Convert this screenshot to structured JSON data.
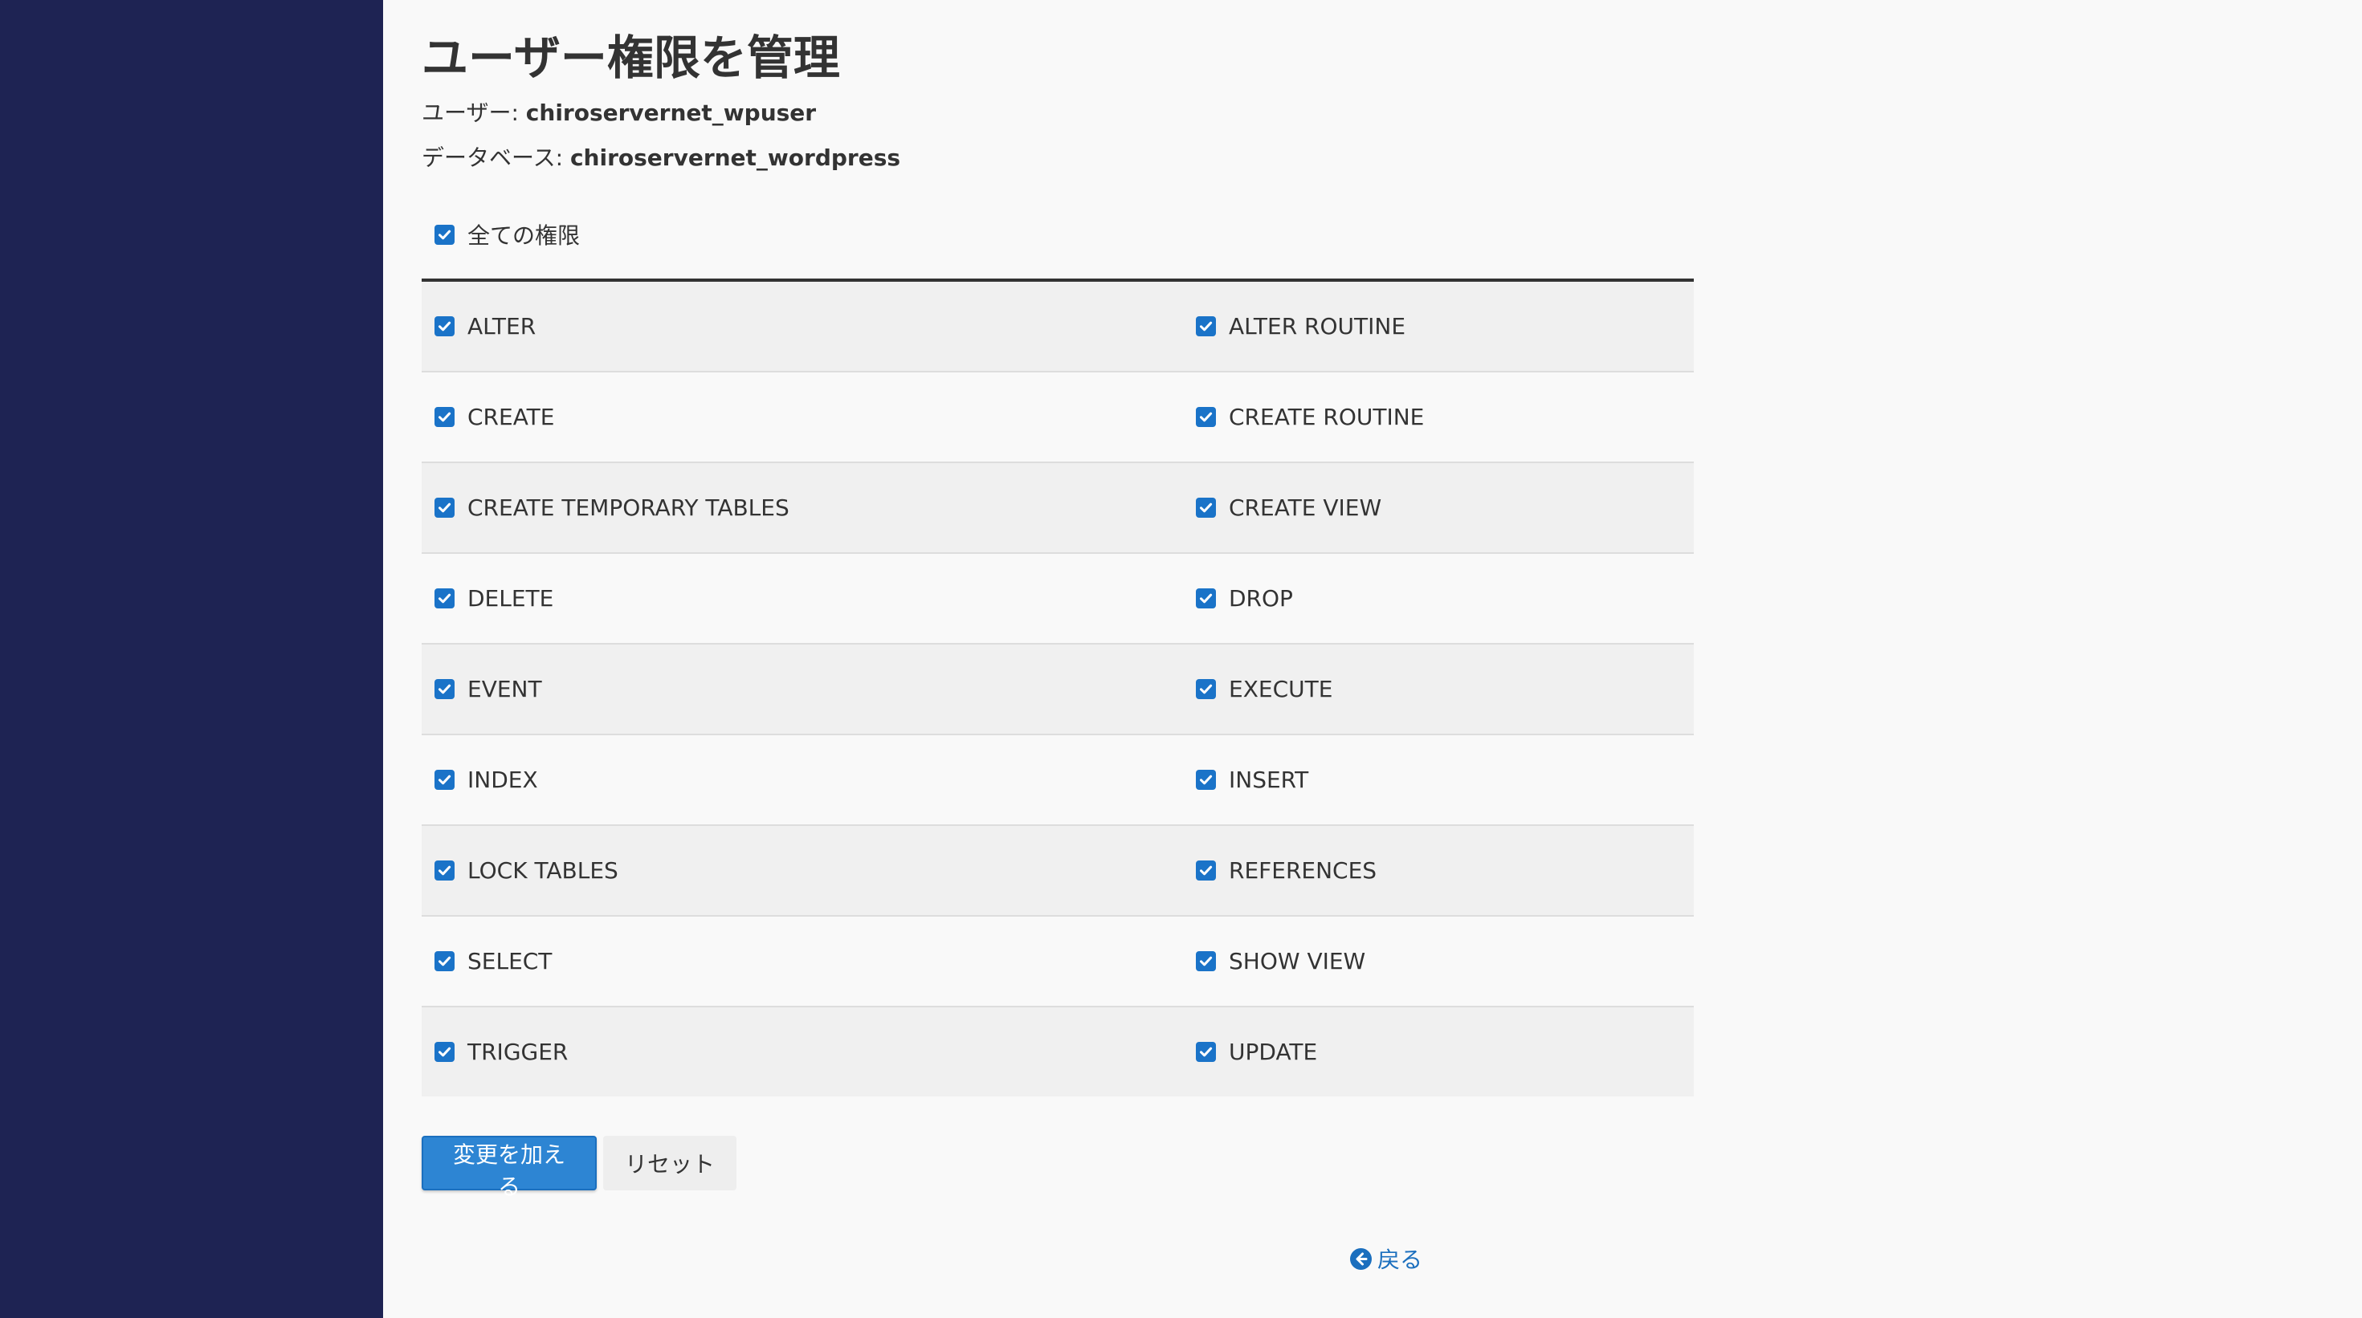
{
  "page": {
    "title": "ユーザー権限を管理"
  },
  "info": {
    "user_label": "ユーザー: ",
    "user_value": "chiroservernet_wpuser",
    "db_label": "データベース: ",
    "db_value": "chiroservernet_wordpress"
  },
  "all_privileges": {
    "label": "全ての権限",
    "checked": true
  },
  "privileges": {
    "rows": [
      {
        "left": "ALTER",
        "right": "ALTER ROUTINE"
      },
      {
        "left": "CREATE",
        "right": "CREATE ROUTINE"
      },
      {
        "left": "CREATE TEMPORARY TABLES",
        "right": "CREATE VIEW"
      },
      {
        "left": "DELETE",
        "right": "DROP"
      },
      {
        "left": "EVENT",
        "right": "EXECUTE"
      },
      {
        "left": "INDEX",
        "right": "INSERT"
      },
      {
        "left": "LOCK TABLES",
        "right": "REFERENCES"
      },
      {
        "left": "SELECT",
        "right": "SHOW VIEW"
      },
      {
        "left": "TRIGGER",
        "right": "UPDATE"
      }
    ],
    "all_checked": true
  },
  "buttons": {
    "apply_label": "変更を加える",
    "reset_label": "リセット"
  },
  "back": {
    "label": "戻る",
    "icon": "arrow-circle-left-icon"
  },
  "colors": {
    "sidebar": "#1e2353",
    "accent": "#2d85d3",
    "checkbox": "#1a73c8"
  }
}
